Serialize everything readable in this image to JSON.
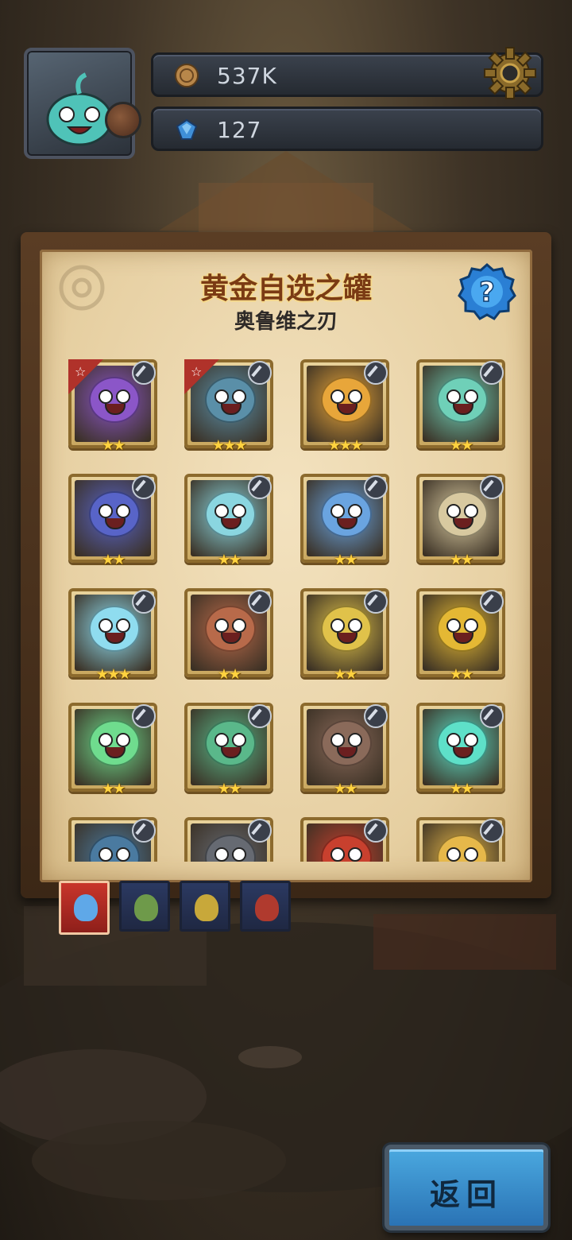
{
  "hud": {
    "avatar_icon": "player-avatar-icon",
    "gold": {
      "icon": "gold-coin-icon",
      "value": "537K"
    },
    "gems": {
      "icon": "blue-gem-icon",
      "value": "127"
    },
    "settings_icon": "gear-icon"
  },
  "panel": {
    "title": "黄金自选之罐",
    "subtitle": "奥鲁维之刃",
    "help_label": "?"
  },
  "hero_cards": [
    {
      "stars": "★★",
      "featured": true,
      "class": "sword",
      "color": "#8b56c8"
    },
    {
      "stars": "★★★",
      "featured": true,
      "class": "sword",
      "color": "#5a8fa8"
    },
    {
      "stars": "★★★",
      "featured": false,
      "class": "sword",
      "color": "#e8a63a"
    },
    {
      "stars": "★★",
      "featured": false,
      "class": "sword",
      "color": "#6fd0b8"
    },
    {
      "stars": "★★",
      "featured": false,
      "class": "sword",
      "color": "#5864c8"
    },
    {
      "stars": "★★",
      "featured": false,
      "class": "sword",
      "color": "#8ad6e0"
    },
    {
      "stars": "★★",
      "featured": false,
      "class": "magic",
      "color": "#6aa4e0"
    },
    {
      "stars": "★★",
      "featured": false,
      "class": "sword",
      "color": "#d8c9a0"
    },
    {
      "stars": "★★★",
      "featured": false,
      "class": "spiral",
      "color": "#8fdcef"
    },
    {
      "stars": "★★",
      "featured": false,
      "class": "sword",
      "color": "#b86a4a"
    },
    {
      "stars": "★★",
      "featured": false,
      "class": "magic",
      "color": "#e0c24a"
    },
    {
      "stars": "★★",
      "featured": false,
      "class": "magic",
      "color": "#e4b834"
    },
    {
      "stars": "★★",
      "featured": false,
      "class": "magic",
      "color": "#6fdc8e"
    },
    {
      "stars": "★★",
      "featured": false,
      "class": "sword",
      "color": "#5ab88a"
    },
    {
      "stars": "★★",
      "featured": false,
      "class": "magic",
      "color": "#8a6a5a"
    },
    {
      "stars": "★★",
      "featured": false,
      "class": "magic",
      "color": "#5ee0c8"
    },
    {
      "stars": "",
      "featured": false,
      "class": "spiral",
      "color": "#4a7aa0"
    },
    {
      "stars": "",
      "featured": false,
      "class": "sword",
      "color": "#666a72"
    },
    {
      "stars": "",
      "featured": false,
      "class": "magic",
      "color": "#c8402e"
    },
    {
      "stars": "",
      "featured": false,
      "class": "spiral",
      "color": "#e6b84a"
    }
  ],
  "tabs": [
    {
      "name": "faction-tab-blue",
      "color": "#5fa8e8",
      "active": true
    },
    {
      "name": "faction-tab-green",
      "color": "#6e9a4a",
      "active": false
    },
    {
      "name": "faction-tab-yellow",
      "color": "#c8a83a",
      "active": false
    },
    {
      "name": "faction-tab-red",
      "color": "#b03a2e",
      "active": false
    }
  ],
  "back_button": {
    "label": "返回"
  }
}
